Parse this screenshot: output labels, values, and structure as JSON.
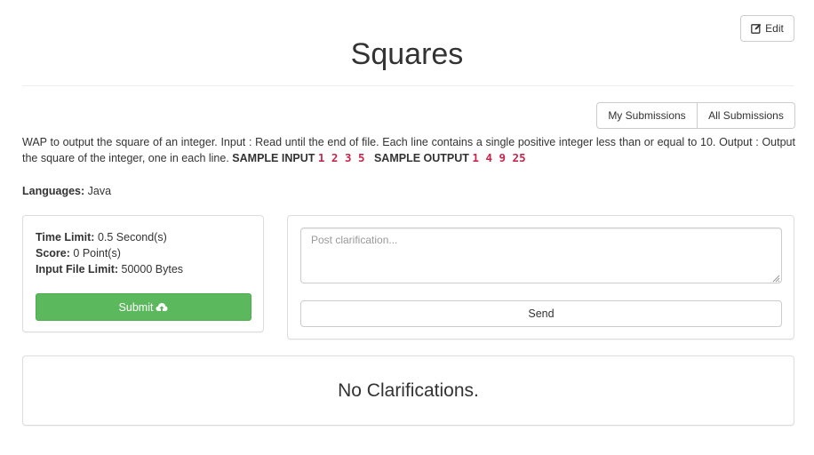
{
  "header": {
    "edit_label": "Edit",
    "edit_icon": "edit-icon",
    "title": "Squares"
  },
  "submissions": {
    "my_label": "My Submissions",
    "all_label": "All Submissions"
  },
  "problem": {
    "description": "WAP to output the square of an integer. Input : Read until the end of file. Each line contains a single positive integer less than or equal to 10. Output : Output the square of the integer, one in each line.",
    "sample_input_label": "SAMPLE INPUT",
    "sample_input": "1 2 3 5",
    "sample_output_label": "SAMPLE OUTPUT",
    "sample_output": "1 4 9 25",
    "languages_label": "Languages:",
    "languages_value": "Java"
  },
  "limits": {
    "time_label": "Time Limit:",
    "time_value": "0.5 Second(s)",
    "score_label": "Score:",
    "score_value": "0 Point(s)",
    "file_label": "Input File Limit:",
    "file_value": "50000 Bytes",
    "submit_label": "Submit",
    "submit_icon": "cloud-upload-icon"
  },
  "clarification": {
    "placeholder": "Post clarification...",
    "value": "",
    "send_label": "Send",
    "empty_message": "No Clarifications."
  },
  "colors": {
    "submit_green": "#5cb85c",
    "code_red": "#c7254e",
    "border": "#dddddd"
  }
}
